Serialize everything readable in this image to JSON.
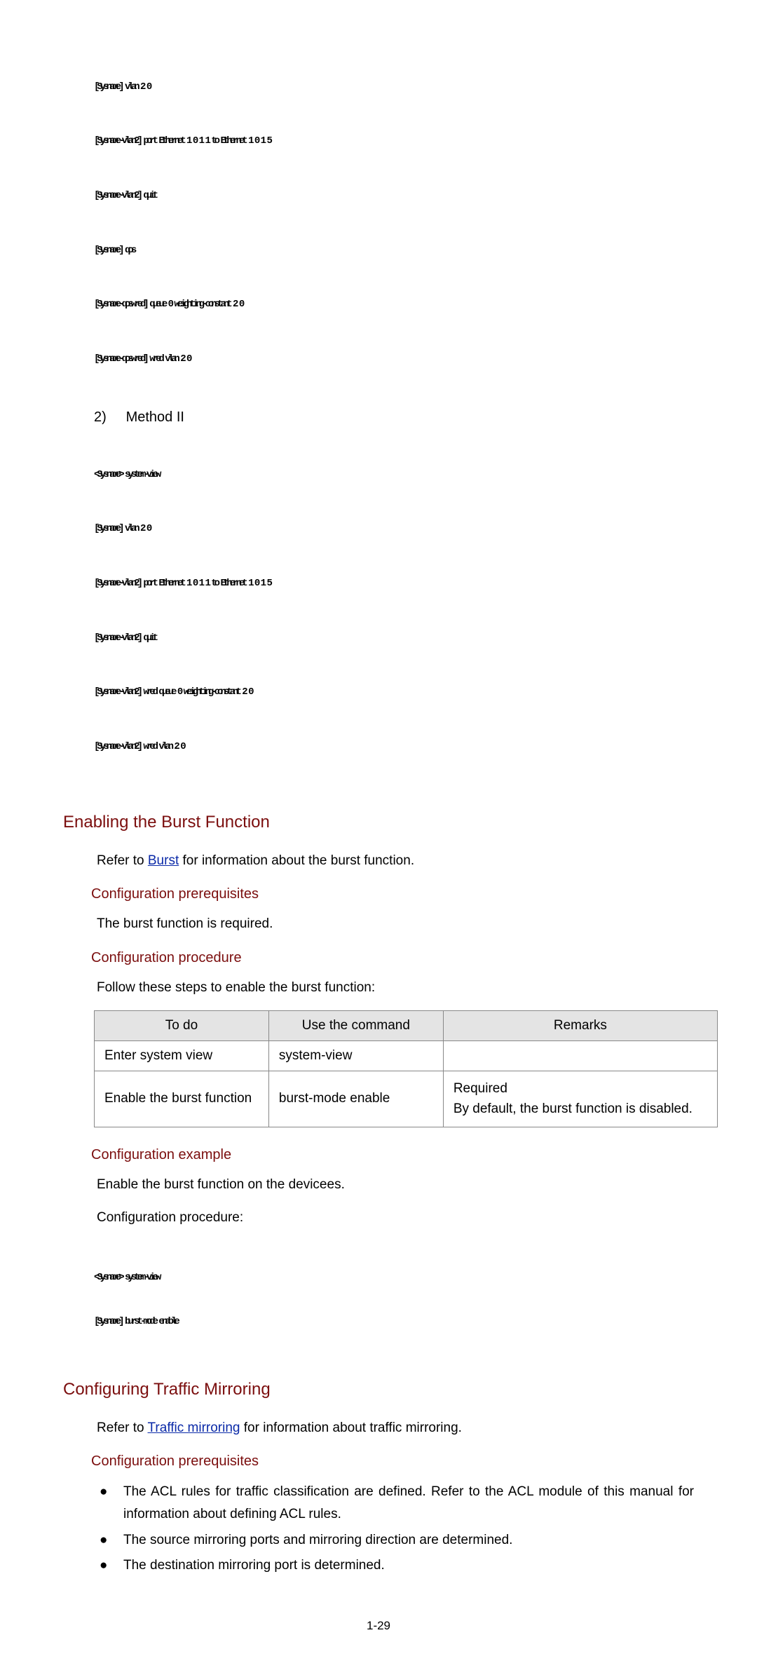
{
  "preMono1": [
    "[Sysname] vlan 2 0",
    "[Sysname-vlan2] port Ethernet 1 0 1 1 to Ethernet 1 0 1 5",
    "[Sysname-vlan2] quit",
    "[Sysname] qos",
    "[Sysname-qoswred] queue 0 weighting-constant 2 0",
    "[Sysname-qoswred] wred vlan 2 0"
  ],
  "method2": {
    "num": "2)",
    "label": "Method II"
  },
  "preMono2": [
    "<Sysname> system-view",
    "[Sysname] vlan 2 0",
    "[Sysname-vlan2] port Ethernet 1 0 1 1 to Ethernet 1 0 1 5",
    "[Sysname-vlan2] quit",
    "[Sysname-vlan2] wred queue 0 weighting-constant 2 0",
    "[Sysname-vlan2] wred vlan 2 0"
  ],
  "h2_burst": "Enabling the Burst Function",
  "burst_intro_pre": "Refer to ",
  "burst_intro_link": "Burst",
  "burst_intro_post": " for information about the burst function.",
  "h3_prereq": "Configuration prerequisites",
  "burst_prereq_text": "The burst function is required.",
  "h3_proc": "Configuration procedure",
  "burst_proc_text": "Follow these steps to enable the burst function:",
  "table": {
    "headers": [
      "To do",
      "Use the command",
      "Remarks"
    ],
    "rows": [
      {
        "todo": "Enter system view",
        "cmd": "system-view",
        "remarks": ""
      },
      {
        "todo": "Enable the burst function",
        "cmd": "burst-mode enable",
        "remarks_line1": "Required",
        "remarks_line2": "By default, the burst function is disabled."
      }
    ]
  },
  "h3_example": "Configuration example",
  "burst_example_text1": "Enable the burst function on the devicees.",
  "burst_example_text2": "Configuration procedure:",
  "preMono3": [
    "<Sysname> system-view",
    "[Sysname] burst-mode enable"
  ],
  "h2_mirror": "Configuring Traffic Mirroring",
  "mirror_intro_pre": "Refer to ",
  "mirror_intro_link": "Traffic mirroring",
  "mirror_intro_post": " for information about traffic mirroring.",
  "h3_prereq2": "Configuration prerequisites",
  "bullets": [
    "The ACL rules for traffic classification are defined. Refer to the ACL module of this manual for information about defining ACL rules.",
    "The source mirroring ports and mirroring direction are determined.",
    "The destination mirroring port is determined."
  ],
  "page_num": "1-29"
}
